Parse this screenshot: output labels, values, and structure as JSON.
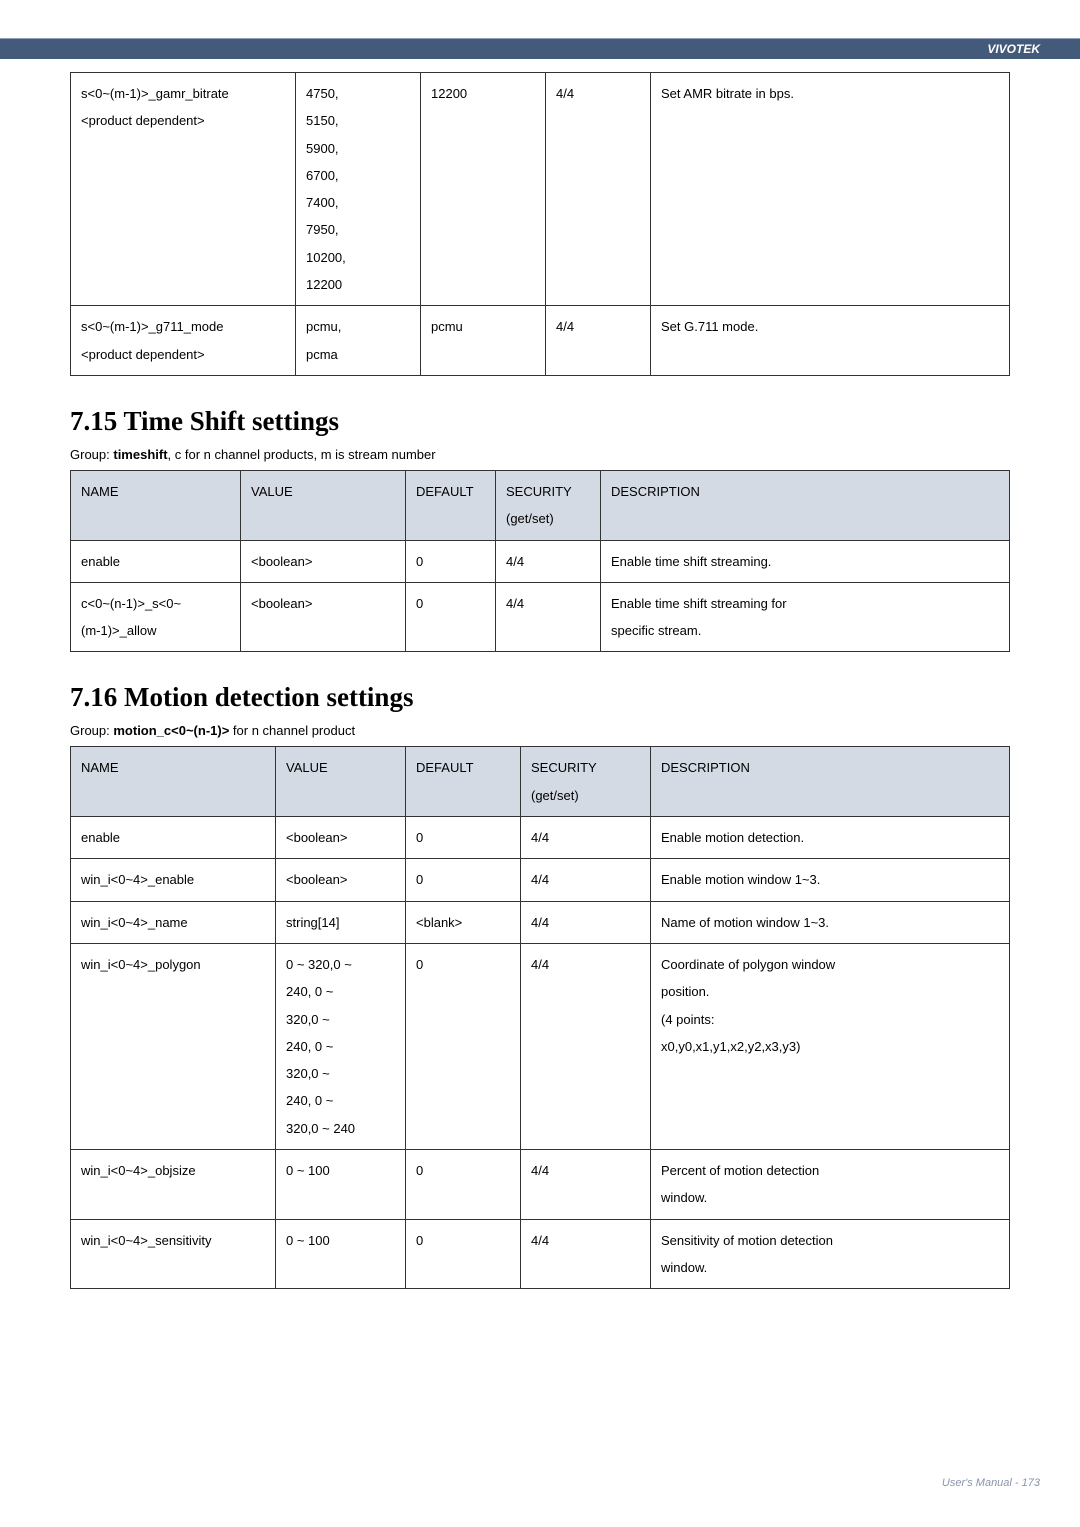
{
  "header": {
    "brand": "VIVOTEK"
  },
  "table1": {
    "rows": [
      {
        "name_line1": "s<0~(m-1)>_gamr_bitrate",
        "name_line2": "<product dependent>",
        "value": "4750, 5150, 5900, 6700, 7400, 7950, 10200, 12200",
        "default": "12200",
        "security": "4/4",
        "description": "Set AMR bitrate in bps."
      },
      {
        "name_line1": "s<0~(m-1)>_g711_mode",
        "name_line2": "<product dependent>",
        "value": "pcmu, pcma",
        "default": "pcmu",
        "security": "4/4",
        "description": "Set G.711 mode."
      }
    ]
  },
  "section715": {
    "title": "7.15 Time Shift settings",
    "group_prefix": "Group: ",
    "group_name": "timeshift",
    "group_suffix": ", c for n channel products, m is stream number",
    "headers": {
      "name": "NAME",
      "value": "VALUE",
      "default": "DEFAULT",
      "security": "SECURITY",
      "security_sub": "(get/set)",
      "description": "DESCRIPTION"
    },
    "rows": [
      {
        "name": "enable",
        "value": "<boolean>",
        "default": "0",
        "security": "4/4",
        "description": "Enable time shift streaming."
      },
      {
        "name": "c<0~(n-1)>_s<0~(m-1)>_allow",
        "value": "<boolean>",
        "default": "0",
        "security": "4/4",
        "description": "Enable time shift streaming for specific stream."
      }
    ]
  },
  "section716": {
    "title": "7.16 Motion detection settings",
    "group_prefix": "Group: ",
    "group_name": "motion_c<0~(n-1)>",
    "group_suffix": " for n channel product",
    "headers": {
      "name": "NAME",
      "value": "VALUE",
      "default": "DEFAULT",
      "security": "SECURITY",
      "security_sub": "(get/set)",
      "description": "DESCRIPTION"
    },
    "rows": [
      {
        "name": "enable",
        "value": "<boolean>",
        "default": "0",
        "security": "4/4",
        "description": "Enable motion detection."
      },
      {
        "name": "win_i<0~4>_enable",
        "value": "<boolean>",
        "default": "0",
        "security": "4/4",
        "description": "Enable motion window 1~3."
      },
      {
        "name": "win_i<0~4>_name",
        "value": "string[14]",
        "default": "<blank>",
        "security": "4/4",
        "description": "Name of motion window 1~3."
      },
      {
        "name": "win_i<0~4>_polygon",
        "value": "0 ~ 320,0 ~ 240, 0 ~ 320,0 ~ 240, 0 ~ 320,0 ~ 240, 0 ~ 320,0 ~ 240",
        "default": "0",
        "security": "4/4",
        "description": "Coordinate of polygon window position.\n(4 points: x0,y0,x1,y1,x2,y2,x3,y3)"
      },
      {
        "name": "win_i<0~4>_objsize",
        "value": "0 ~ 100",
        "default": "0",
        "security": "4/4",
        "description": "Percent of motion detection window."
      },
      {
        "name": "win_i<0~4>_sensitivity",
        "value": "0 ~ 100",
        "default": "0",
        "security": "4/4",
        "description": "Sensitivity of motion detection window."
      }
    ]
  },
  "footer": {
    "text": "User's Manual - 173"
  }
}
